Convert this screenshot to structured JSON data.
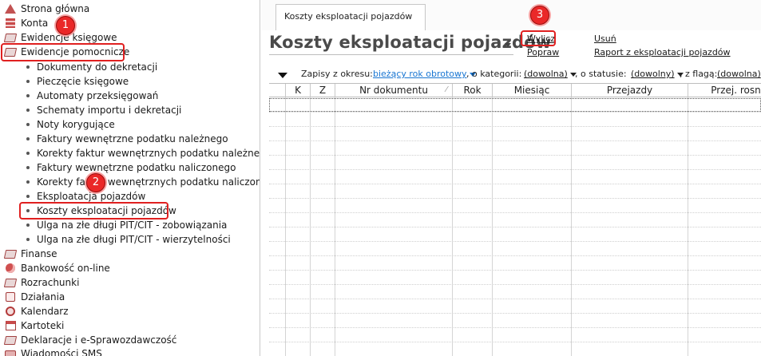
{
  "sidebar": {
    "items": [
      {
        "label": "Strona główna",
        "icon": "home-icon"
      },
      {
        "label": "Konta",
        "icon": "accounts-icon"
      },
      {
        "label": "Ewidencje księgowe",
        "icon": "ledger-icon"
      },
      {
        "label": "Ewidencje pomocnicze",
        "icon": "auxiliary-records-icon"
      }
    ],
    "subitems": [
      "Dokumenty do dekretacji",
      "Pieczęcie księgowe",
      "Automaty przeksięgowań",
      "Schematy importu i dekretacji",
      "Noty korygujące",
      "Faktury wewnętrzne podatku należnego",
      "Korekty faktur wewnętrznych podatku należnego",
      "Faktury wewnętrzne podatku naliczonego",
      "Korekty faktur wewnętrznych podatku naliczonego",
      "Eksploatacja pojazdów",
      "Koszty eksploatacji pojazdów",
      "Ulga na złe długi PIT/CIT - zobowiązania",
      "Ulga na złe długi PIT/CIT - wierzytelności"
    ],
    "bottom_items": [
      {
        "label": "Finanse",
        "icon": "finance-icon"
      },
      {
        "label": "Bankowość on-line",
        "icon": "online-banking-icon"
      },
      {
        "label": "Rozrachunki",
        "icon": "settlements-icon"
      },
      {
        "label": "Działania",
        "icon": "actions-icon"
      },
      {
        "label": "Kalendarz",
        "icon": "calendar-icon"
      },
      {
        "label": "Kartoteki",
        "icon": "records-icon"
      },
      {
        "label": "Deklaracje i e-Sprawozdawczość",
        "icon": "declarations-icon"
      },
      {
        "label": "Wiadomości SMS",
        "icon": "sms-icon"
      }
    ]
  },
  "annotations": {
    "badge1": "1",
    "badge2": "2",
    "badge3": "3",
    "color": "#e02020"
  },
  "tab": {
    "label": "Koszty eksploatacji pojazdów"
  },
  "page": {
    "title": "Koszty eksploatacji pojazdów"
  },
  "actions": {
    "wylicz": "Wylicz",
    "popraw": "Popraw",
    "usun": "Usuń",
    "raport": "Raport z eksploatacji pojazdów"
  },
  "filter": {
    "period_label": "Zapisy z okresu:",
    "period_value": "bieżący rok obrotowy",
    "category_label": ", o kategorii:",
    "category_value": "(dowolna)",
    "status_label": ", o statusie:",
    "status_value": "(dowolny)",
    "flag_label": ", z flagą:",
    "flag_value": "(dowolna)"
  },
  "grid": {
    "columns": [
      "K",
      "Z",
      "Nr dokumentu",
      "Rok",
      "Miesiąc",
      "Przejazdy",
      "Przej. rosn"
    ],
    "sort_indicator": "⁄"
  },
  "colors": {
    "link_blue": "#1976d2",
    "icon_red": "#c84a4a"
  }
}
